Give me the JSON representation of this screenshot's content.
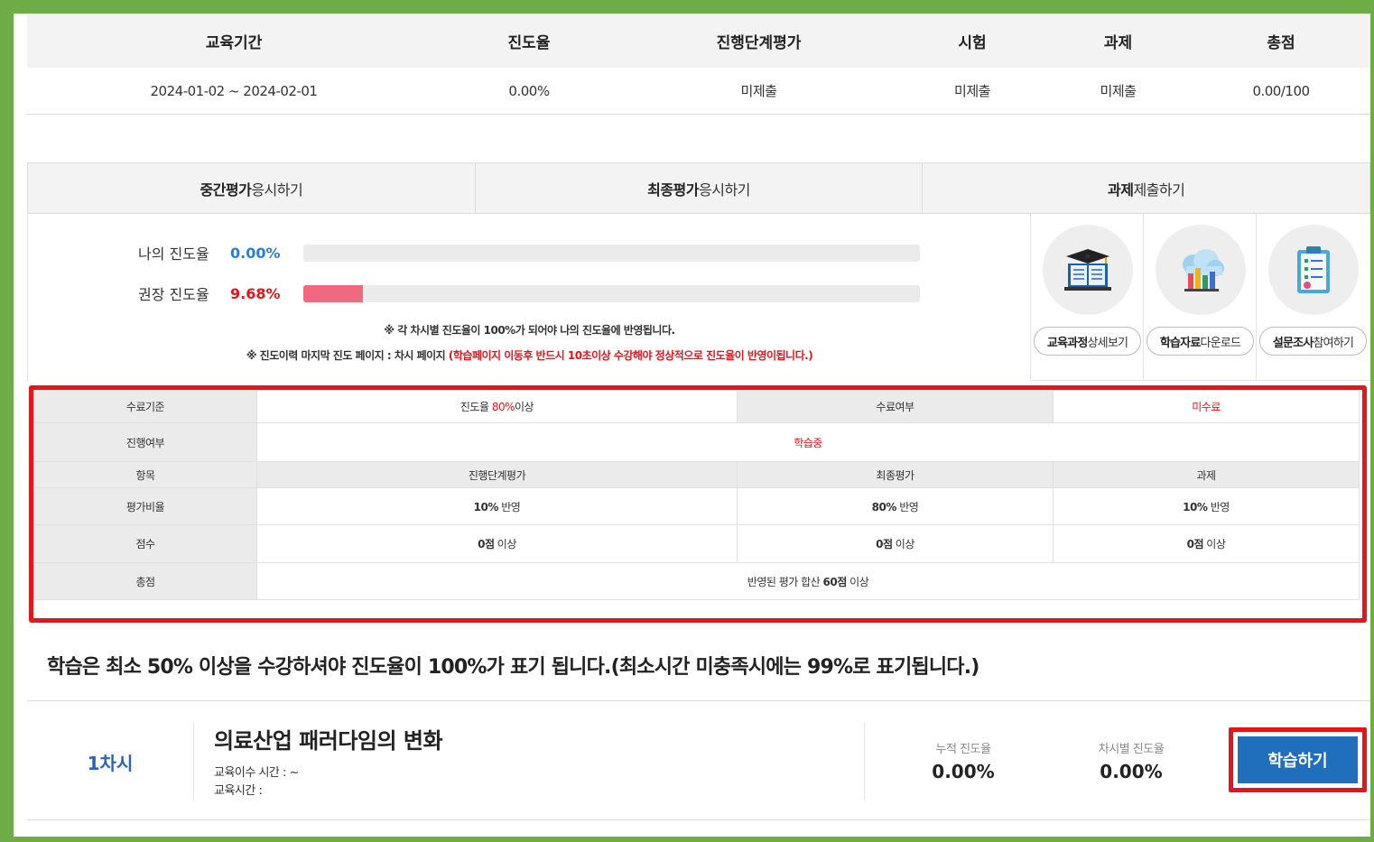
{
  "summary": {
    "headers": [
      "교육기간",
      "진도율",
      "진행단계평가",
      "시험",
      "과제",
      "총점"
    ],
    "values": [
      "2024-01-02 ~ 2024-02-01",
      "0.00%",
      "미제출",
      "미제출",
      "미제출",
      "0.00/100"
    ]
  },
  "tabs": [
    {
      "bold": "중간평가",
      "rest": "응시하기"
    },
    {
      "bold": "최종평가",
      "rest": "응시하기"
    },
    {
      "bold": "과제",
      "rest": "제출하기"
    }
  ],
  "progress": {
    "mine_label": "나의 진도율",
    "mine_value": "0.00%",
    "mine_fraction": 0.0,
    "recommended_label": "권장 진도율",
    "recommended_value": "9.68%",
    "recommended_fraction": 0.0968,
    "note1": "※ 각 차시별 진도율이 100%가 되어야 나의 진도율에 반영됩니다.",
    "note2_prefix": "※ 진도이력 마지막 진도 페이지 : 차시 페이지 ",
    "note2_red": "(학습페이지 이동후 반드시 10초이상 수강해야 정상적으로 진도율이 반영이됩니다.)",
    "mine_color": "#2a7fd4",
    "recommended_color": "#e8141b"
  },
  "icon_buttons": [
    {
      "icon": "book-graduation-icon",
      "bold": "교육과정",
      "rest": " 상세보기"
    },
    {
      "icon": "cloud-download-icon",
      "bold": "학습자료",
      "rest": " 다운로드"
    },
    {
      "icon": "survey-clipboard-icon",
      "bold": "설문조사",
      "rest": " 참여하기"
    }
  ],
  "criteria": {
    "completion_standard_label": "수료기준",
    "completion_standard_prefix": "진도율 ",
    "completion_standard_red": "80%",
    "completion_standard_suffix": "이상",
    "completion_status_label": "수료여부",
    "completion_status_value": "미수료",
    "progress_status_label": "진행여부",
    "progress_status_value": "학습중",
    "item_label": "항목",
    "items": [
      "진행단계평가",
      "최종평가",
      "과제"
    ],
    "ratio_label": "평가비율",
    "ratios": [
      {
        "bold": "10%",
        "rest": " 반영"
      },
      {
        "bold": "80%",
        "rest": " 반영"
      },
      {
        "bold": "10%",
        "rest": " 반영"
      }
    ],
    "score_label": "점수",
    "scores": [
      {
        "bold": "0점",
        "rest": " 이상"
      },
      {
        "bold": "0점",
        "rest": " 이상"
      },
      {
        "bold": "0점",
        "rest": " 이상"
      }
    ],
    "total_label": "총점",
    "total_prefix": "반영된 평가 합산 ",
    "total_bold": "60점",
    "total_suffix": " 이상"
  },
  "info_text": "학습은 최소 50% 이상을 수강하셔야 진도율이 100%가 표기 됩니다.(최소시간 미충족시에는 99%로 표기됩니다.)",
  "lesson": {
    "number": "1차시",
    "title": "의료산업 패러다임의 변화",
    "completion_time": "교육이수 시간 : ~",
    "study_time": "교육시간 :",
    "cumulative_label": "누적 진도율",
    "cumulative_value": "0.00%",
    "per_session_label": "차시별 진도율",
    "per_session_value": "0.00%",
    "study_button": "학습하기"
  }
}
